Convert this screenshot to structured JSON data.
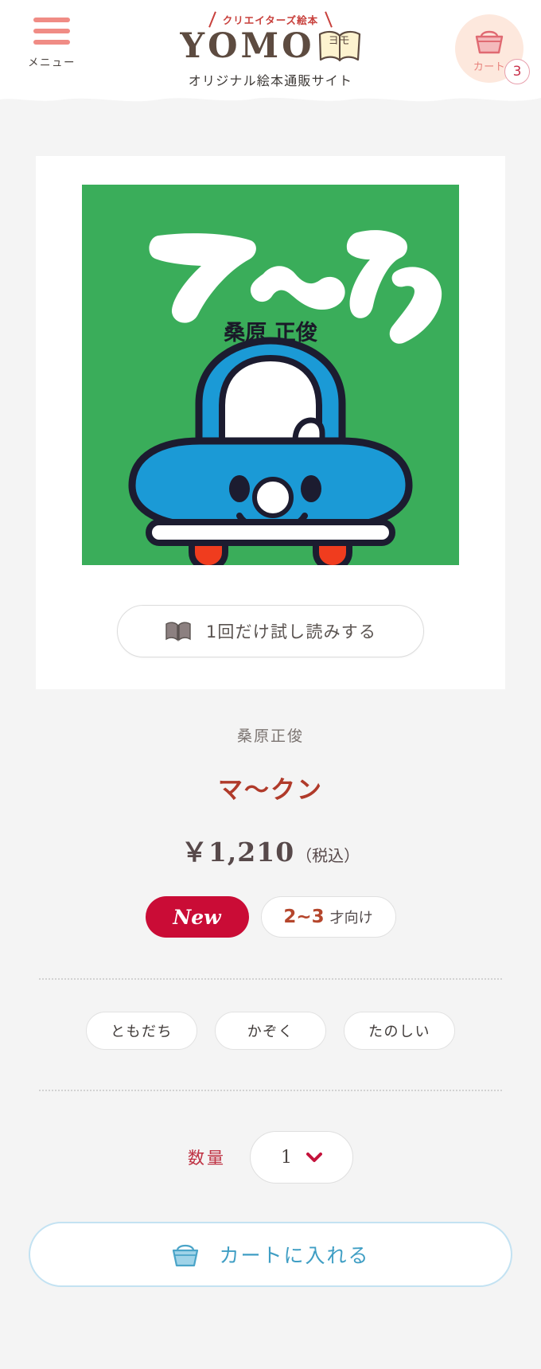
{
  "header": {
    "menu": {
      "label": "メニュー",
      "icon": "hamburger-icon"
    },
    "logo": {
      "tagline": "クリエイターズ絵本",
      "word": "YOMO",
      "book_text": "ヨモ",
      "subtitle": "オリジナル絵本通販サイト"
    },
    "cart": {
      "label": "カート",
      "badge_count": "3",
      "icon": "basket-icon"
    }
  },
  "product": {
    "cover": {
      "title": "マ〜クン",
      "author": "桑原 正俊",
      "background_color": "#3aad5a",
      "car_color": "#1b9ad6",
      "wheel_color": "#f03c1e"
    },
    "trial_button": {
      "label": "1回だけ試し読みする",
      "icon": "open-book-icon"
    },
    "author": "桑原正俊",
    "title": "マ〜クン",
    "price": "￥1,210",
    "price_tax_note": "（税込）",
    "badges": {
      "new": "New",
      "age_number": "2~3",
      "age_suffix": "才向け"
    },
    "tags": [
      "ともだち",
      "かぞく",
      "たのしい"
    ],
    "quantity": {
      "label": "数量",
      "value": "1",
      "chevron": "chevron-down-icon"
    },
    "add_to_cart": {
      "label": "カートに入れる",
      "icon": "basket-icon"
    }
  },
  "colors": {
    "accent_red": "#ca0c36",
    "title_red": "#b03a2a",
    "cart_blue": "#3f9ec4",
    "menu_pink": "#f08c85",
    "cart_peach": "#fde8dd"
  }
}
